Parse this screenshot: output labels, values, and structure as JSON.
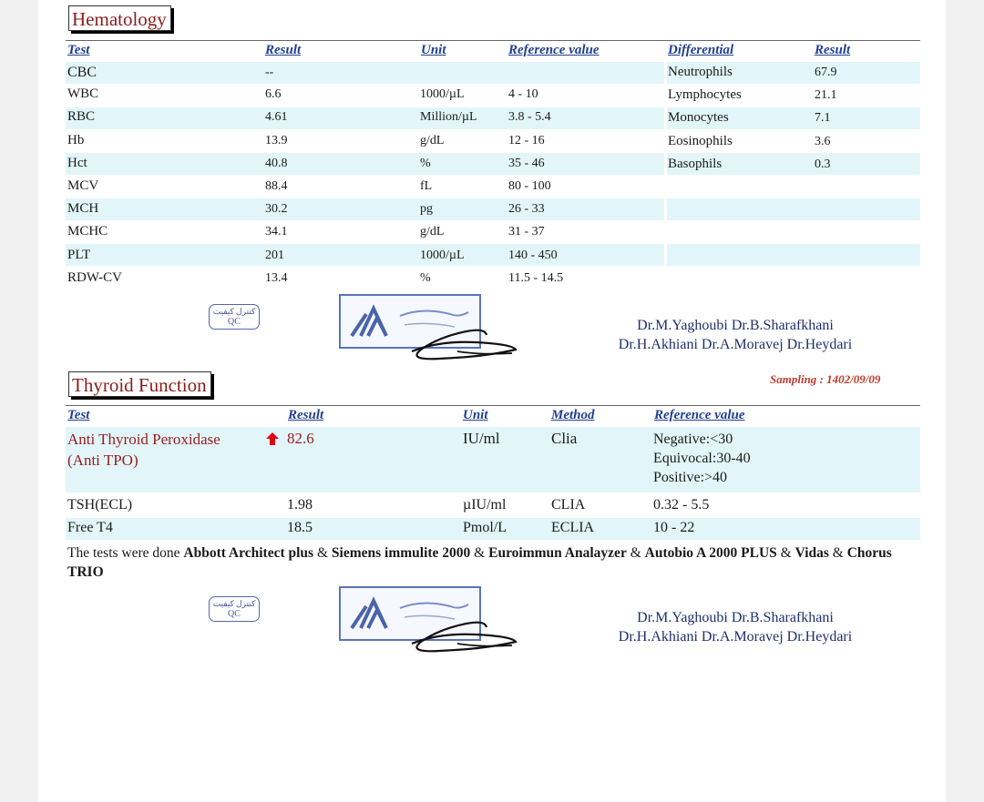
{
  "hematology": {
    "title": "Hematology",
    "headers": {
      "test": "Test",
      "result": "Result",
      "unit": "Unit",
      "reference": "Reference value",
      "differential": "Differential",
      "diff_result": "Result"
    },
    "rows": [
      {
        "test": "CBC",
        "result": "--",
        "unit": "",
        "ref": ""
      },
      {
        "test": "WBC",
        "result": "6.6",
        "unit": "1000/µL",
        "ref": "4 - 10"
      },
      {
        "test": "RBC",
        "result": "4.61",
        "unit": "Million/µL",
        "ref": "3.8 - 5.4"
      },
      {
        "test": "Hb",
        "result": "13.9",
        "unit": "g/dL",
        "ref": "12 - 16"
      },
      {
        "test": "Hct",
        "result": "40.8",
        "unit": "%",
        "ref": "35 - 46"
      },
      {
        "test": "MCV",
        "result": "88.4",
        "unit": "fL",
        "ref": "80 - 100"
      },
      {
        "test": "MCH",
        "result": "30.2",
        "unit": "pg",
        "ref": "26 - 33"
      },
      {
        "test": "MCHC",
        "result": "34.1",
        "unit": "g/dL",
        "ref": "31 - 37"
      },
      {
        "test": "PLT",
        "result": "201",
        "unit": "1000/µL",
        "ref": "140 - 450"
      },
      {
        "test": "RDW-CV",
        "result": "13.4",
        "unit": "%",
        "ref": "11.5 - 14.5"
      }
    ],
    "differential": [
      {
        "name": "Neutrophils",
        "value": "67.9"
      },
      {
        "name": "Lymphocytes",
        "value": "21.1"
      },
      {
        "name": "Monocytes",
        "value": "7.1"
      },
      {
        "name": "Eosinophils",
        "value": "3.6"
      },
      {
        "name": "Basophils",
        "value": "0.3"
      }
    ]
  },
  "stamps": {
    "qc_persian": "کنترل کیفیت",
    "qc_latin": "QC"
  },
  "doctors": {
    "line1": "Dr.M.Yaghoubi   Dr.B.Sharafkhani",
    "line2": "Dr.H.Akhiani   Dr.A.Moravej   Dr.Heydari"
  },
  "thyroid": {
    "title": "Thyroid Function",
    "sampling": "Sampling : 1402/09/09",
    "headers": {
      "test": "Test",
      "result": "Result",
      "unit": "Unit",
      "method": "Method",
      "reference": "Reference value"
    },
    "anti_tpo": {
      "test_line1": "Anti Thyroid Peroxidase",
      "test_line2": "(Anti TPO)",
      "result": "82.6",
      "unit": "IU/ml",
      "method": "Clia",
      "ref_line1": "Negative:<30",
      "ref_line2": "Equivocal:30-40",
      "ref_line3": "Positive:>40"
    },
    "rows": [
      {
        "test": "TSH(ECL)",
        "result": "1.98",
        "unit": "µIU/ml",
        "method": "CLIA",
        "ref": "0.32 - 5.5"
      },
      {
        "test": "Free T4",
        "result": "18.5",
        "unit": "Pmol/L",
        "method": "ECLIA",
        "ref": "10 - 22"
      }
    ]
  },
  "note": {
    "prefix": "The tests were done ",
    "p1": "Abbott Architect plus",
    "s1": " & ",
    "p2": "Siemens immulite 2000",
    "s2": " & ",
    "p3": "Euroimmun Analayzer",
    "s3": " & ",
    "p4": "Autobio A 2000 PLUS",
    "s4": " & ",
    "p5": "Vidas",
    "s5": " & ",
    "p6": "Chorus TRIO"
  },
  "colors": {
    "header_blue": "#1f3f8f",
    "band": "#e2f6fa",
    "title_red": "#8b1c1c",
    "sampling_red": "#c0392b",
    "flag_red": "#e0000f"
  }
}
